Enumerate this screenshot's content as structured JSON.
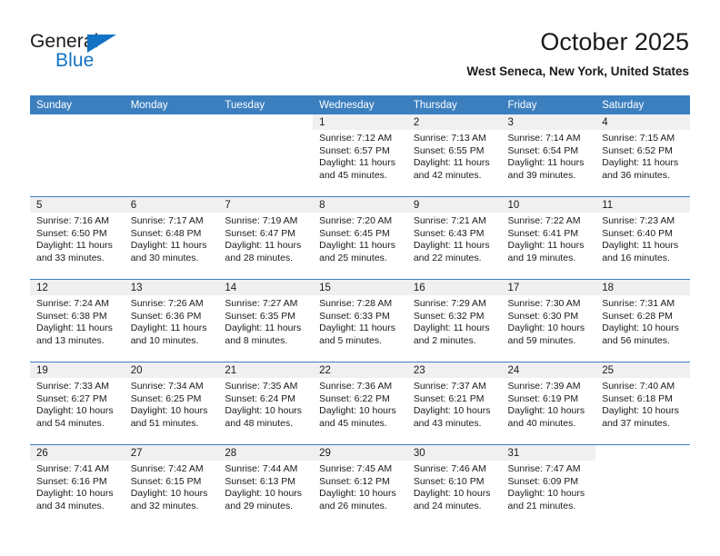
{
  "brand": {
    "name_top": "General",
    "name_bottom": "Blue",
    "accent_color": "#1273c4",
    "triangle_icon": "triangle-icon"
  },
  "header": {
    "title": "October 2025",
    "subtitle": "West Seneca, New York, United States"
  },
  "theme": {
    "header_row_bg": "#3c7fbf",
    "daynum_band_bg": "#f0f0f0",
    "grid_line": "#3c7fbf",
    "text": "#1a1a1a",
    "page_bg": "#ffffff"
  },
  "weekdays": [
    "Sunday",
    "Monday",
    "Tuesday",
    "Wednesday",
    "Thursday",
    "Friday",
    "Saturday"
  ],
  "weeks": [
    [
      {
        "day": "",
        "blank": true,
        "lines": []
      },
      {
        "day": "",
        "blank": true,
        "lines": []
      },
      {
        "day": "",
        "blank": true,
        "lines": []
      },
      {
        "day": "1",
        "lines": [
          "Sunrise: 7:12 AM",
          "Sunset: 6:57 PM",
          "Daylight: 11 hours",
          "and 45 minutes."
        ]
      },
      {
        "day": "2",
        "lines": [
          "Sunrise: 7:13 AM",
          "Sunset: 6:55 PM",
          "Daylight: 11 hours",
          "and 42 minutes."
        ]
      },
      {
        "day": "3",
        "lines": [
          "Sunrise: 7:14 AM",
          "Sunset: 6:54 PM",
          "Daylight: 11 hours",
          "and 39 minutes."
        ]
      },
      {
        "day": "4",
        "lines": [
          "Sunrise: 7:15 AM",
          "Sunset: 6:52 PM",
          "Daylight: 11 hours",
          "and 36 minutes."
        ]
      }
    ],
    [
      {
        "day": "5",
        "lines": [
          "Sunrise: 7:16 AM",
          "Sunset: 6:50 PM",
          "Daylight: 11 hours",
          "and 33 minutes."
        ]
      },
      {
        "day": "6",
        "lines": [
          "Sunrise: 7:17 AM",
          "Sunset: 6:48 PM",
          "Daylight: 11 hours",
          "and 30 minutes."
        ]
      },
      {
        "day": "7",
        "lines": [
          "Sunrise: 7:19 AM",
          "Sunset: 6:47 PM",
          "Daylight: 11 hours",
          "and 28 minutes."
        ]
      },
      {
        "day": "8",
        "lines": [
          "Sunrise: 7:20 AM",
          "Sunset: 6:45 PM",
          "Daylight: 11 hours",
          "and 25 minutes."
        ]
      },
      {
        "day": "9",
        "lines": [
          "Sunrise: 7:21 AM",
          "Sunset: 6:43 PM",
          "Daylight: 11 hours",
          "and 22 minutes."
        ]
      },
      {
        "day": "10",
        "lines": [
          "Sunrise: 7:22 AM",
          "Sunset: 6:41 PM",
          "Daylight: 11 hours",
          "and 19 minutes."
        ]
      },
      {
        "day": "11",
        "lines": [
          "Sunrise: 7:23 AM",
          "Sunset: 6:40 PM",
          "Daylight: 11 hours",
          "and 16 minutes."
        ]
      }
    ],
    [
      {
        "day": "12",
        "lines": [
          "Sunrise: 7:24 AM",
          "Sunset: 6:38 PM",
          "Daylight: 11 hours",
          "and 13 minutes."
        ]
      },
      {
        "day": "13",
        "lines": [
          "Sunrise: 7:26 AM",
          "Sunset: 6:36 PM",
          "Daylight: 11 hours",
          "and 10 minutes."
        ]
      },
      {
        "day": "14",
        "lines": [
          "Sunrise: 7:27 AM",
          "Sunset: 6:35 PM",
          "Daylight: 11 hours",
          "and 8 minutes."
        ]
      },
      {
        "day": "15",
        "lines": [
          "Sunrise: 7:28 AM",
          "Sunset: 6:33 PM",
          "Daylight: 11 hours",
          "and 5 minutes."
        ]
      },
      {
        "day": "16",
        "lines": [
          "Sunrise: 7:29 AM",
          "Sunset: 6:32 PM",
          "Daylight: 11 hours",
          "and 2 minutes."
        ]
      },
      {
        "day": "17",
        "lines": [
          "Sunrise: 7:30 AM",
          "Sunset: 6:30 PM",
          "Daylight: 10 hours",
          "and 59 minutes."
        ]
      },
      {
        "day": "18",
        "lines": [
          "Sunrise: 7:31 AM",
          "Sunset: 6:28 PM",
          "Daylight: 10 hours",
          "and 56 minutes."
        ]
      }
    ],
    [
      {
        "day": "19",
        "lines": [
          "Sunrise: 7:33 AM",
          "Sunset: 6:27 PM",
          "Daylight: 10 hours",
          "and 54 minutes."
        ]
      },
      {
        "day": "20",
        "lines": [
          "Sunrise: 7:34 AM",
          "Sunset: 6:25 PM",
          "Daylight: 10 hours",
          "and 51 minutes."
        ]
      },
      {
        "day": "21",
        "lines": [
          "Sunrise: 7:35 AM",
          "Sunset: 6:24 PM",
          "Daylight: 10 hours",
          "and 48 minutes."
        ]
      },
      {
        "day": "22",
        "lines": [
          "Sunrise: 7:36 AM",
          "Sunset: 6:22 PM",
          "Daylight: 10 hours",
          "and 45 minutes."
        ]
      },
      {
        "day": "23",
        "lines": [
          "Sunrise: 7:37 AM",
          "Sunset: 6:21 PM",
          "Daylight: 10 hours",
          "and 43 minutes."
        ]
      },
      {
        "day": "24",
        "lines": [
          "Sunrise: 7:39 AM",
          "Sunset: 6:19 PM",
          "Daylight: 10 hours",
          "and 40 minutes."
        ]
      },
      {
        "day": "25",
        "lines": [
          "Sunrise: 7:40 AM",
          "Sunset: 6:18 PM",
          "Daylight: 10 hours",
          "and 37 minutes."
        ]
      }
    ],
    [
      {
        "day": "26",
        "lines": [
          "Sunrise: 7:41 AM",
          "Sunset: 6:16 PM",
          "Daylight: 10 hours",
          "and 34 minutes."
        ]
      },
      {
        "day": "27",
        "lines": [
          "Sunrise: 7:42 AM",
          "Sunset: 6:15 PM",
          "Daylight: 10 hours",
          "and 32 minutes."
        ]
      },
      {
        "day": "28",
        "lines": [
          "Sunrise: 7:44 AM",
          "Sunset: 6:13 PM",
          "Daylight: 10 hours",
          "and 29 minutes."
        ]
      },
      {
        "day": "29",
        "lines": [
          "Sunrise: 7:45 AM",
          "Sunset: 6:12 PM",
          "Daylight: 10 hours",
          "and 26 minutes."
        ]
      },
      {
        "day": "30",
        "lines": [
          "Sunrise: 7:46 AM",
          "Sunset: 6:10 PM",
          "Daylight: 10 hours",
          "and 24 minutes."
        ]
      },
      {
        "day": "31",
        "lines": [
          "Sunrise: 7:47 AM",
          "Sunset: 6:09 PM",
          "Daylight: 10 hours",
          "and 21 minutes."
        ]
      },
      {
        "day": "",
        "blank": true,
        "lines": []
      }
    ]
  ]
}
